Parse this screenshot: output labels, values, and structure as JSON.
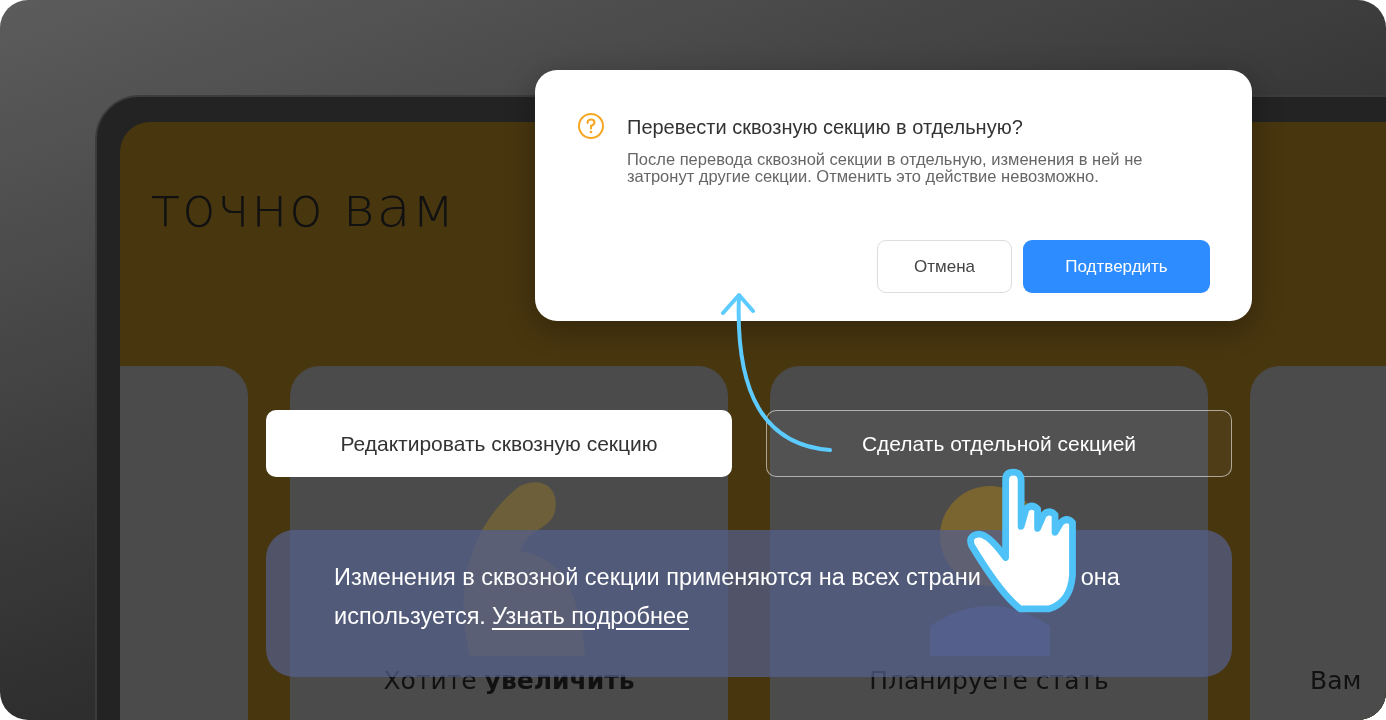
{
  "page_headline": "точно вам",
  "cards": [
    {
      "title": "Хотите **увеличить**"
    },
    {
      "title": "Планируете стать"
    },
    {
      "title": "Вам"
    }
  ],
  "dialog": {
    "title": "Перевести сквозную секцию в отдельную?",
    "message": "После перевода сквозной секции в отдельную, изменения в ней не затронут другие секции. Отменить это действие невозможно.",
    "buttons": [
      {
        "label": "Отмена",
        "kind": "secondary"
      },
      {
        "label": "Подтвердить",
        "kind": "primary"
      }
    ]
  },
  "section_actions": [
    {
      "label": "Редактировать сквозную секцию",
      "kind": "filled"
    },
    {
      "label": "Сделать отдельной секцией",
      "kind": "outline"
    }
  ],
  "notice": {
    "text_parts": [
      "Изменения в сквозной секции применяются на всех страни",
      "она"
    ],
    "text_end": "используется.",
    "link": "Узнать подробнее"
  }
}
